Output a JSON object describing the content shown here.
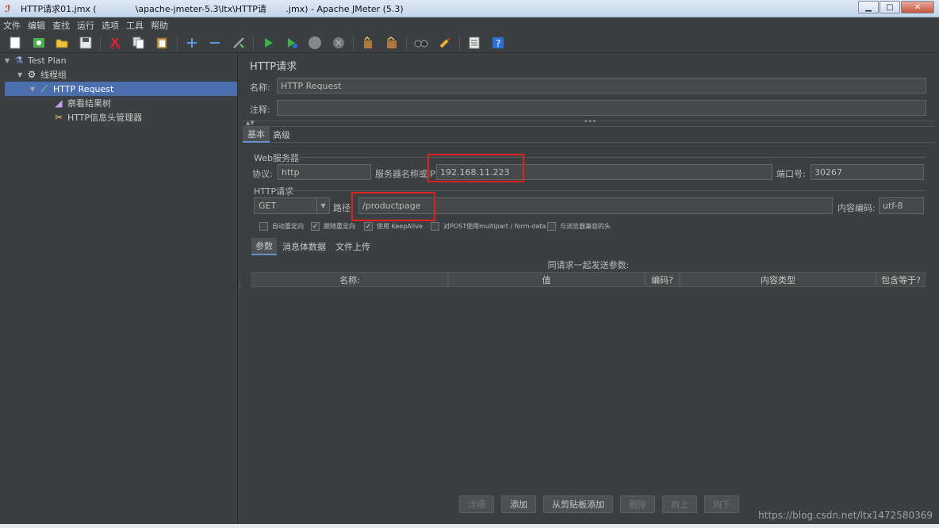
{
  "window": {
    "title": "HTTP请求01.jmx (              \\apache-jmeter-5.3\\ltx\\HTTP请       .jmx) - Apache JMeter (5.3)",
    "minimize": "▁",
    "maximize": "□",
    "close": "✕"
  },
  "menu": [
    "文件",
    "编辑",
    "查找",
    "运行",
    "选项",
    "工具",
    "帮助"
  ],
  "toolbar_icons": [
    "new-icon",
    "templates-icon",
    "open-icon",
    "save-icon",
    "cut-icon",
    "copy-icon",
    "paste-icon",
    "expand-icon",
    "collapse-icon",
    "toggle-icon",
    "start-icon",
    "start-no-pause-icon",
    "stop-icon",
    "shutdown-icon",
    "clear-icon",
    "clear-all-icon",
    "search-icon",
    "reset-search-icon",
    "function-helper-icon",
    "help-icon"
  ],
  "tree": {
    "items": [
      {
        "label": "Test Plan"
      },
      {
        "label": "线程组"
      },
      {
        "label": "HTTP Request"
      },
      {
        "label": "察看结果树"
      },
      {
        "label": "HTTP信息头管理器"
      }
    ]
  },
  "main": {
    "title": "HTTP请求",
    "name_label": "名称:",
    "name_value": "HTTP Request",
    "comment_label": "注释:",
    "comment_value": "",
    "tabs": [
      "基本",
      "高级"
    ],
    "web_server": {
      "title": "Web服务器",
      "protocol_label": "协议:",
      "protocol_value": "http",
      "server_label": "服务器名称或IP:",
      "server_value": "192.168.11.223",
      "port_label": "端口号:",
      "port_value": "30267"
    },
    "http_request": {
      "title": "HTTP请求",
      "method": "GET",
      "path_label": "路径:",
      "path_value": "/productpage",
      "encoding_label": "内容编码:",
      "encoding_value": "utf-8"
    },
    "checkboxes": [
      {
        "label": "自动重定向",
        "checked": false
      },
      {
        "label": "跟随重定向",
        "checked": true
      },
      {
        "label": "使用 KeepAlive",
        "checked": true
      },
      {
        "label": "对POST使用multipart / form-data",
        "checked": false
      },
      {
        "label": "与浏览器兼容的头",
        "checked": false
      }
    ],
    "subtabs": [
      "参数",
      "消息体数据",
      "文件上传"
    ],
    "params_caption": "同请求一起发送参数:",
    "table_headers": [
      "名称:",
      "值",
      "编码?",
      "内容类型",
      "包含等于?"
    ],
    "buttons": {
      "detail": "详细",
      "add": "添加",
      "add_from_clipboard": "从剪贴板添加",
      "delete": "删除",
      "up": "向上",
      "down": "向下"
    }
  },
  "watermark": "https://blog.csdn.net/ltx1472580369",
  "colors": {
    "background": "#3c3f41",
    "selection": "#4b6eaf",
    "highlight_box": "#e0231f"
  }
}
